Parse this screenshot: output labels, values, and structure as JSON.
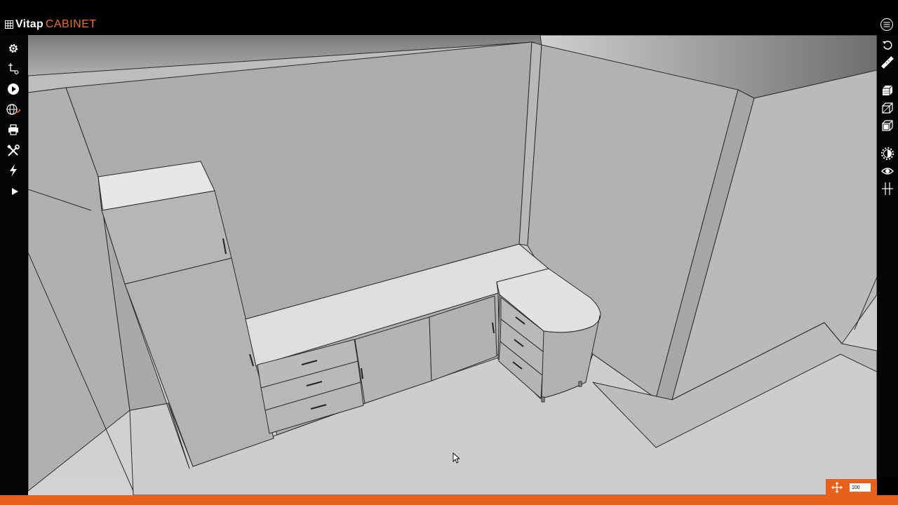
{
  "app": {
    "brand_main": "Vitap",
    "brand_accent": "CABINET",
    "accent_color": "#e8722a",
    "toolbar_color": "#e8611c"
  },
  "left_toolbar": [
    {
      "icon": "gear-icon"
    },
    {
      "icon": "path-node-icon"
    },
    {
      "icon": "play-circle-icon"
    },
    {
      "icon": "globe-export-icon"
    },
    {
      "icon": "printer-icon"
    },
    {
      "icon": "tools-icon"
    },
    {
      "icon": "lightning-icon"
    },
    {
      "icon": "play-arrow-icon"
    }
  ],
  "right_toolbar": [
    {
      "icon": "undo-icon"
    },
    {
      "icon": "ruler-icon"
    },
    {
      "icon": "solid-view-icon"
    },
    {
      "icon": "wireframe-cube-icon"
    },
    {
      "icon": "box-view-icon"
    },
    {
      "icon": "light-settings-icon"
    },
    {
      "icon": "eye-icon"
    },
    {
      "icon": "section-cut-icon"
    }
  ],
  "zoom": {
    "value": "100"
  }
}
